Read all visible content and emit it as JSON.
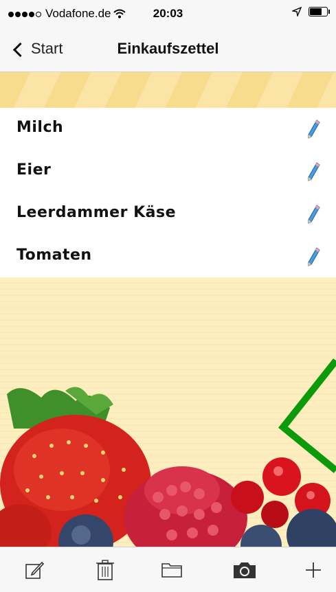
{
  "status": {
    "carrier": "Vodafone.de",
    "time": "20:03",
    "battery_level": 0.7
  },
  "nav": {
    "back_label": "Start",
    "title": "Einkaufszettel"
  },
  "items": [
    {
      "label": "Milch"
    },
    {
      "label": "Eier"
    },
    {
      "label": "Leerdammer Käse"
    },
    {
      "label": "Tomaten"
    }
  ],
  "toolbar": {
    "icons": [
      "compose-icon",
      "trash-icon",
      "folder-icon",
      "camera-icon",
      "plus-icon"
    ]
  },
  "colors": {
    "accent_green": "#0a9a0a",
    "paper": "#fdeec0",
    "stripe": "#f8dc8e"
  }
}
